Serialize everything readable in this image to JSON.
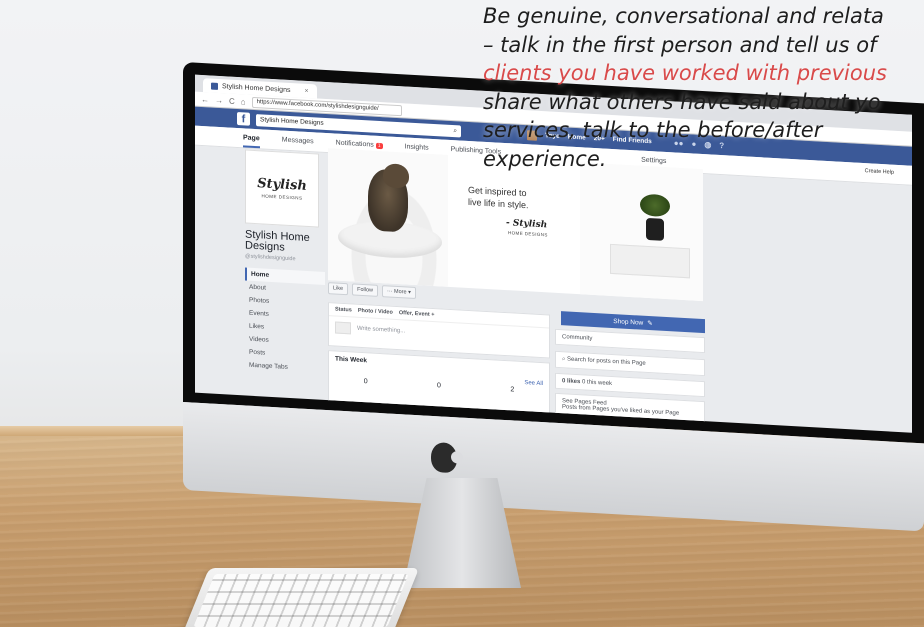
{
  "browser": {
    "tab_title": "Stylish Home Designs",
    "tab_close": "×",
    "url": "https://www.facebook.com/stylishdesignguide/",
    "nav_back": "←",
    "nav_forward": "→",
    "nav_reload": "C",
    "nav_home": "⌂"
  },
  "facebook": {
    "logo": "f",
    "search_value": "Stylish Home Designs",
    "search_icon": "search-icon",
    "user": "Toye",
    "home": "Home",
    "home_count": "20+",
    "find_friends": "Find Friends",
    "help": "Create Help"
  },
  "page_tabs": [
    {
      "label": "Page"
    },
    {
      "label": "Messages"
    },
    {
      "label": "Notifications",
      "badge": "1"
    },
    {
      "label": "Insights"
    },
    {
      "label": "Publishing Tools"
    },
    {
      "label": "Settings"
    }
  ],
  "sidebar": {
    "logo_script": "Stylish",
    "logo_sub": "HOME DESIGNS",
    "page_name": "Stylish Home Designs",
    "handle": "@stylishdesignguide",
    "items": [
      {
        "label": "Home"
      },
      {
        "label": "About"
      },
      {
        "label": "Photos"
      },
      {
        "label": "Events"
      },
      {
        "label": "Likes"
      },
      {
        "label": "Videos"
      },
      {
        "label": "Posts"
      },
      {
        "label": "Manage Tabs"
      }
    ]
  },
  "cover": {
    "tagline_1": "Get inspired to",
    "tagline_2": "live life in style.",
    "script": "- Stylish",
    "sub": "HOME DESIGNS"
  },
  "actions": {
    "like": "Like",
    "follow": "Follow",
    "more": "··· More ▾",
    "shop_now": "Shop Now"
  },
  "composer": {
    "status": "Status",
    "photo_video": "Photo / Video",
    "offer": "Offer, Event +",
    "placeholder": "Write something..."
  },
  "this_week": {
    "title": "This Week",
    "see_all": "See All",
    "stats": [
      "0",
      "0",
      "2"
    ]
  },
  "right_column": {
    "community": "Community",
    "search_posts": "Search for posts on this Page",
    "likes": "0 likes",
    "likes_sub": "0 this week",
    "pages_feed": "See Pages Feed",
    "pages_feed_sub": "Posts from Pages you've liked as your Page"
  },
  "quote": {
    "line1": "Be genuine, conversational and relata",
    "line2": "– talk in the first person and tell us of",
    "line3": "clients you have worked with previous",
    "line4": "share what others have said about yo",
    "line5": "services, talk to the before/after",
    "line6": "experience."
  }
}
